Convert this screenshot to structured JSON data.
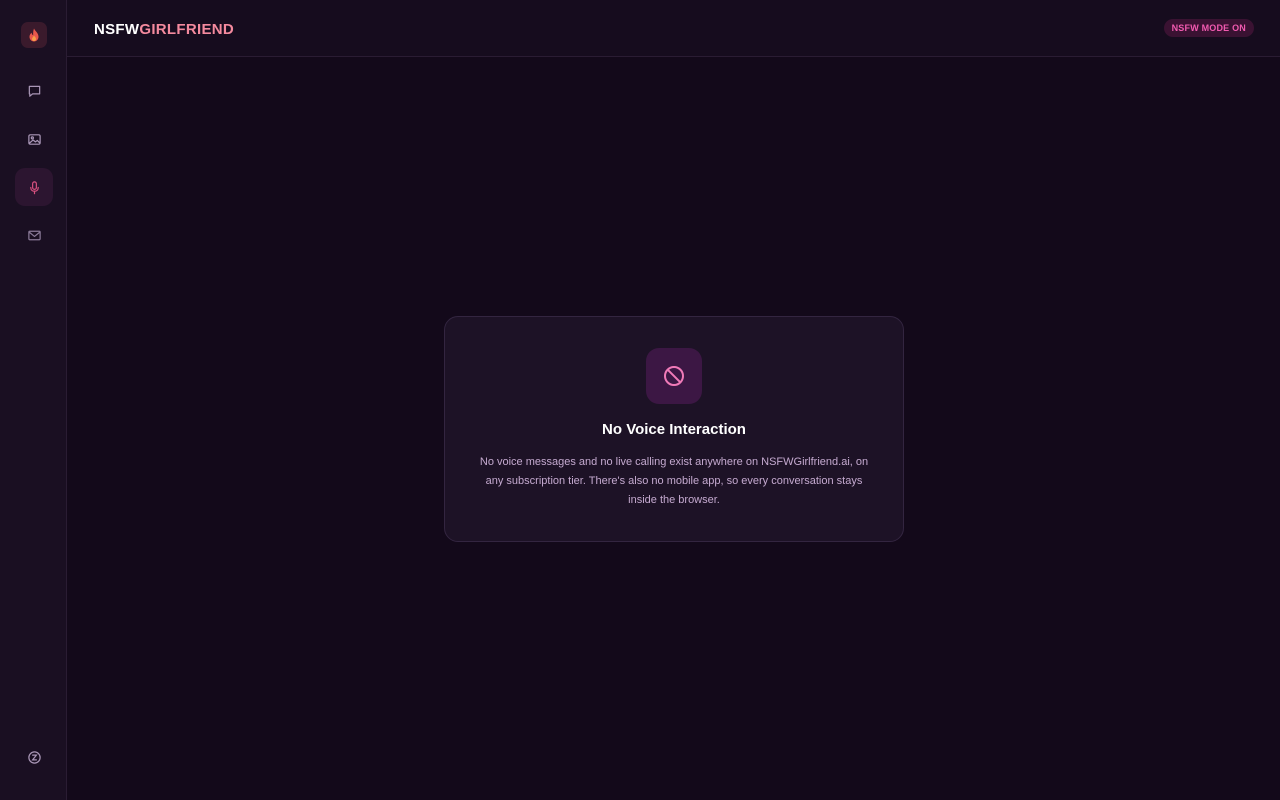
{
  "brand": {
    "part1": "NSFW",
    "part2": "GIRLFRIEND"
  },
  "header": {
    "badge": "NSFW MODE ON"
  },
  "sidebar": {
    "logo_icon": "flame-icon",
    "items": [
      {
        "name": "chat",
        "icon": "chat-bubble-icon",
        "active": false
      },
      {
        "name": "images",
        "icon": "image-icon",
        "active": false
      },
      {
        "name": "voice",
        "icon": "microphone-icon",
        "active": true
      },
      {
        "name": "messages",
        "icon": "mail-icon",
        "active": false
      }
    ],
    "bottom_icon": "coin-icon"
  },
  "card": {
    "icon": "prohibited-icon",
    "title": "No Voice Interaction",
    "body": "No voice messages and no live calling exist anywhere on NSFWGirlfriend.ai, on any subscription tier. There's also no mobile app, so every conversation stays inside the browser."
  },
  "colors": {
    "background": "#13091a",
    "accent_pink": "#f48a9e",
    "badge_text": "#f25ab0",
    "icon_tint": "#f07ab8"
  }
}
